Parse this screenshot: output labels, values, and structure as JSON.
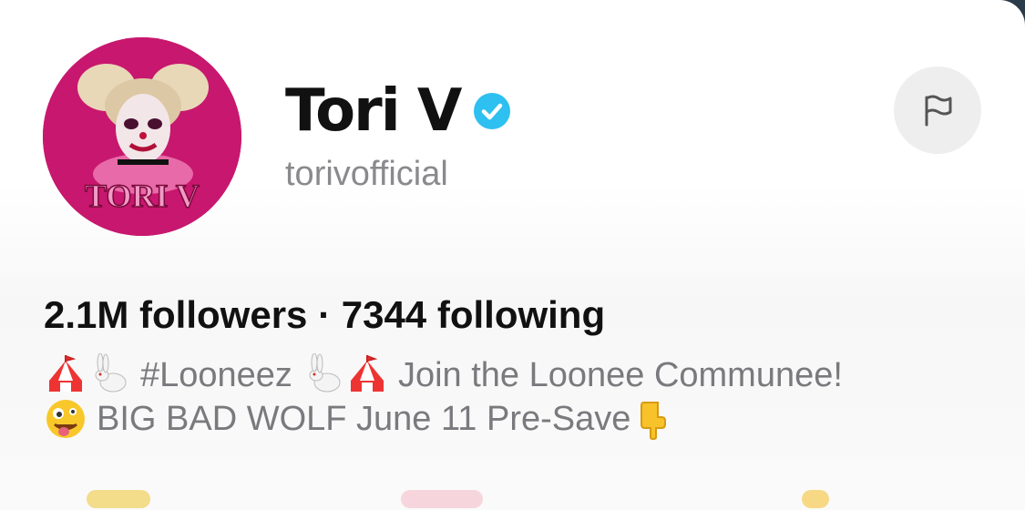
{
  "profile": {
    "display_name": "Tori V",
    "handle": "torivofficial",
    "avatar_text": "TORI V",
    "verified_icon": "verified-badge-icon",
    "flag_icon": "flag-icon"
  },
  "stats": {
    "text": "2.1M followers · 7344 following"
  },
  "bio": {
    "line1_a": "#Looneez",
    "line1_b": "Join the Loonee Communee!",
    "line2": "BIG BAD WOLF June 11  Pre-Save"
  },
  "colors": {
    "avatar_bg": "#c8176e",
    "verified": "#2ec0f0",
    "text_primary": "#111111",
    "text_secondary": "#8a8a8e"
  }
}
